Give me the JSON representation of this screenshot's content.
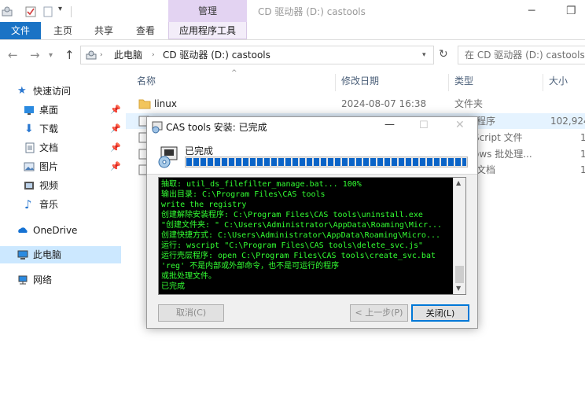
{
  "window": {
    "context_tab": "管理",
    "title": "CD 驱动器 (D:) castools"
  },
  "ribbon": {
    "tabs": [
      "文件",
      "主页",
      "共享",
      "查看",
      "应用程序工具"
    ]
  },
  "address": {
    "crumbs": [
      "此电脑",
      "CD 驱动器 (D:) castools"
    ],
    "search_placeholder": "在 CD 驱动器 (D:) castools"
  },
  "sidebar": {
    "items": [
      {
        "label": "快速访问",
        "icon": "star-icon"
      },
      {
        "label": "桌面",
        "icon": "desktop-icon"
      },
      {
        "label": "下载",
        "icon": "download-icon"
      },
      {
        "label": "文档",
        "icon": "document-icon"
      },
      {
        "label": "图片",
        "icon": "picture-icon"
      },
      {
        "label": "视频",
        "icon": "video-icon"
      },
      {
        "label": "音乐",
        "icon": "music-icon"
      },
      {
        "label": "OneDrive",
        "icon": "cloud-icon"
      },
      {
        "label": "此电脑",
        "icon": "computer-icon"
      },
      {
        "label": "网络",
        "icon": "network-icon"
      }
    ]
  },
  "files": {
    "columns": [
      "名称",
      "修改日期",
      "类型",
      "大小"
    ],
    "rows": [
      {
        "name": "linux",
        "date": "2024-08-07 16:38",
        "type": "文件夹",
        "size": ""
      },
      {
        "name": "",
        "date": "",
        "type": "程序",
        "size": "102,924"
      },
      {
        "name": "",
        "date": "",
        "type": "Script 文件",
        "size": "1"
      },
      {
        "name": "",
        "date": "",
        "type": "ows 批处理...",
        "size": "1"
      },
      {
        "name": "",
        "date": "",
        "type": "文档",
        "size": "1"
      }
    ]
  },
  "installer": {
    "title": "CAS tools 安装: 已完成",
    "status": "已完成",
    "progress": 1.0,
    "log": [
      "抽取: util_ds_filefilter_manage.bat... 100%",
      "输出目录: C:\\Program Files\\CAS tools",
      "write the registry",
      "创建解除安装程序: C:\\Program Files\\CAS tools\\uninstall.exe",
      "\"创建文件夹: \" C:\\Users\\Administrator\\AppData\\Roaming\\Micr...",
      "创建快捷方式: C:\\Users\\Administrator\\AppData\\Roaming\\Micro...",
      "运行: wscript \"C:\\Program Files\\CAS tools\\delete_svc.js\"",
      "运行壳层程序: open C:\\Program Files\\CAS tools\\create_svc.bat",
      "'reg' 不是内部或外部命令，也不是可运行的程序",
      "或批处理文件。",
      "已完成"
    ],
    "buttons": {
      "cancel": "取消(C)",
      "back": "< 上一步(P)",
      "close": "关闭(L)"
    }
  },
  "colors": {
    "accent": "#1a73c5",
    "context_tab": "#e3d3f2",
    "log_text": "#33ff33",
    "progress": "#0a64c8"
  }
}
